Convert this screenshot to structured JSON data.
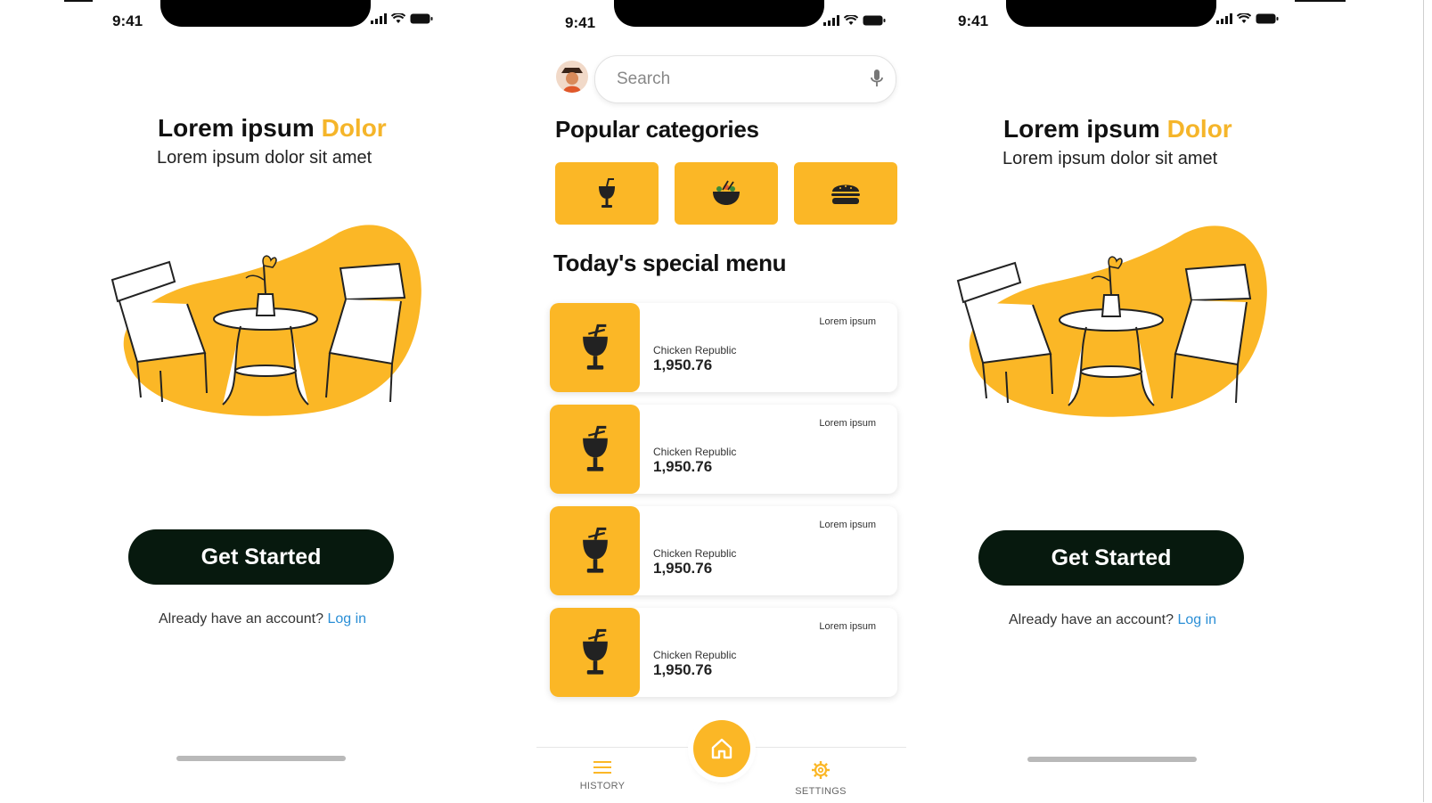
{
  "onboarding_left": {
    "status_time": "9:41",
    "title_main": "Lorem ipsum",
    "title_accent": "Dolor",
    "subtitle": "Lorem ipsum dolor sit amet",
    "cta_label": "Get Started",
    "account_prompt": "Already have an account?",
    "login_label": "Log in"
  },
  "home": {
    "status_time": "9:41",
    "search_placeholder": "Search",
    "popular_title": "Popular categories",
    "categories": [
      {
        "icon": "drink-icon"
      },
      {
        "icon": "salad-bowl-icon"
      },
      {
        "icon": "burger-icon"
      }
    ],
    "special_title": "Today's special menu",
    "menu_items": [
      {
        "tag": "Lorem ipsum",
        "name": "Chicken Republic",
        "price": "1,950.76"
      },
      {
        "tag": "Lorem ipsum",
        "name": "Chicken Republic",
        "price": "1,950.76"
      },
      {
        "tag": "Lorem ipsum",
        "name": "Chicken Republic",
        "price": "1,950.76"
      },
      {
        "tag": "Lorem ipsum",
        "name": "Chicken Republic",
        "price": "1,950.76"
      }
    ],
    "nav": {
      "history": "HISTORY",
      "settings": "SETTINGS"
    }
  },
  "onboarding_right": {
    "status_time": "9:41",
    "title_main": "Lorem ipsum",
    "title_accent": "Dolor",
    "subtitle": "Lorem ipsum dolor sit amet",
    "cta_label": "Get Started",
    "account_prompt": "Already have an account?",
    "login_label": "Log in"
  },
  "colors": {
    "accent": "#fbb726",
    "button_dark": "#07190e",
    "link": "#2b8fd6"
  }
}
